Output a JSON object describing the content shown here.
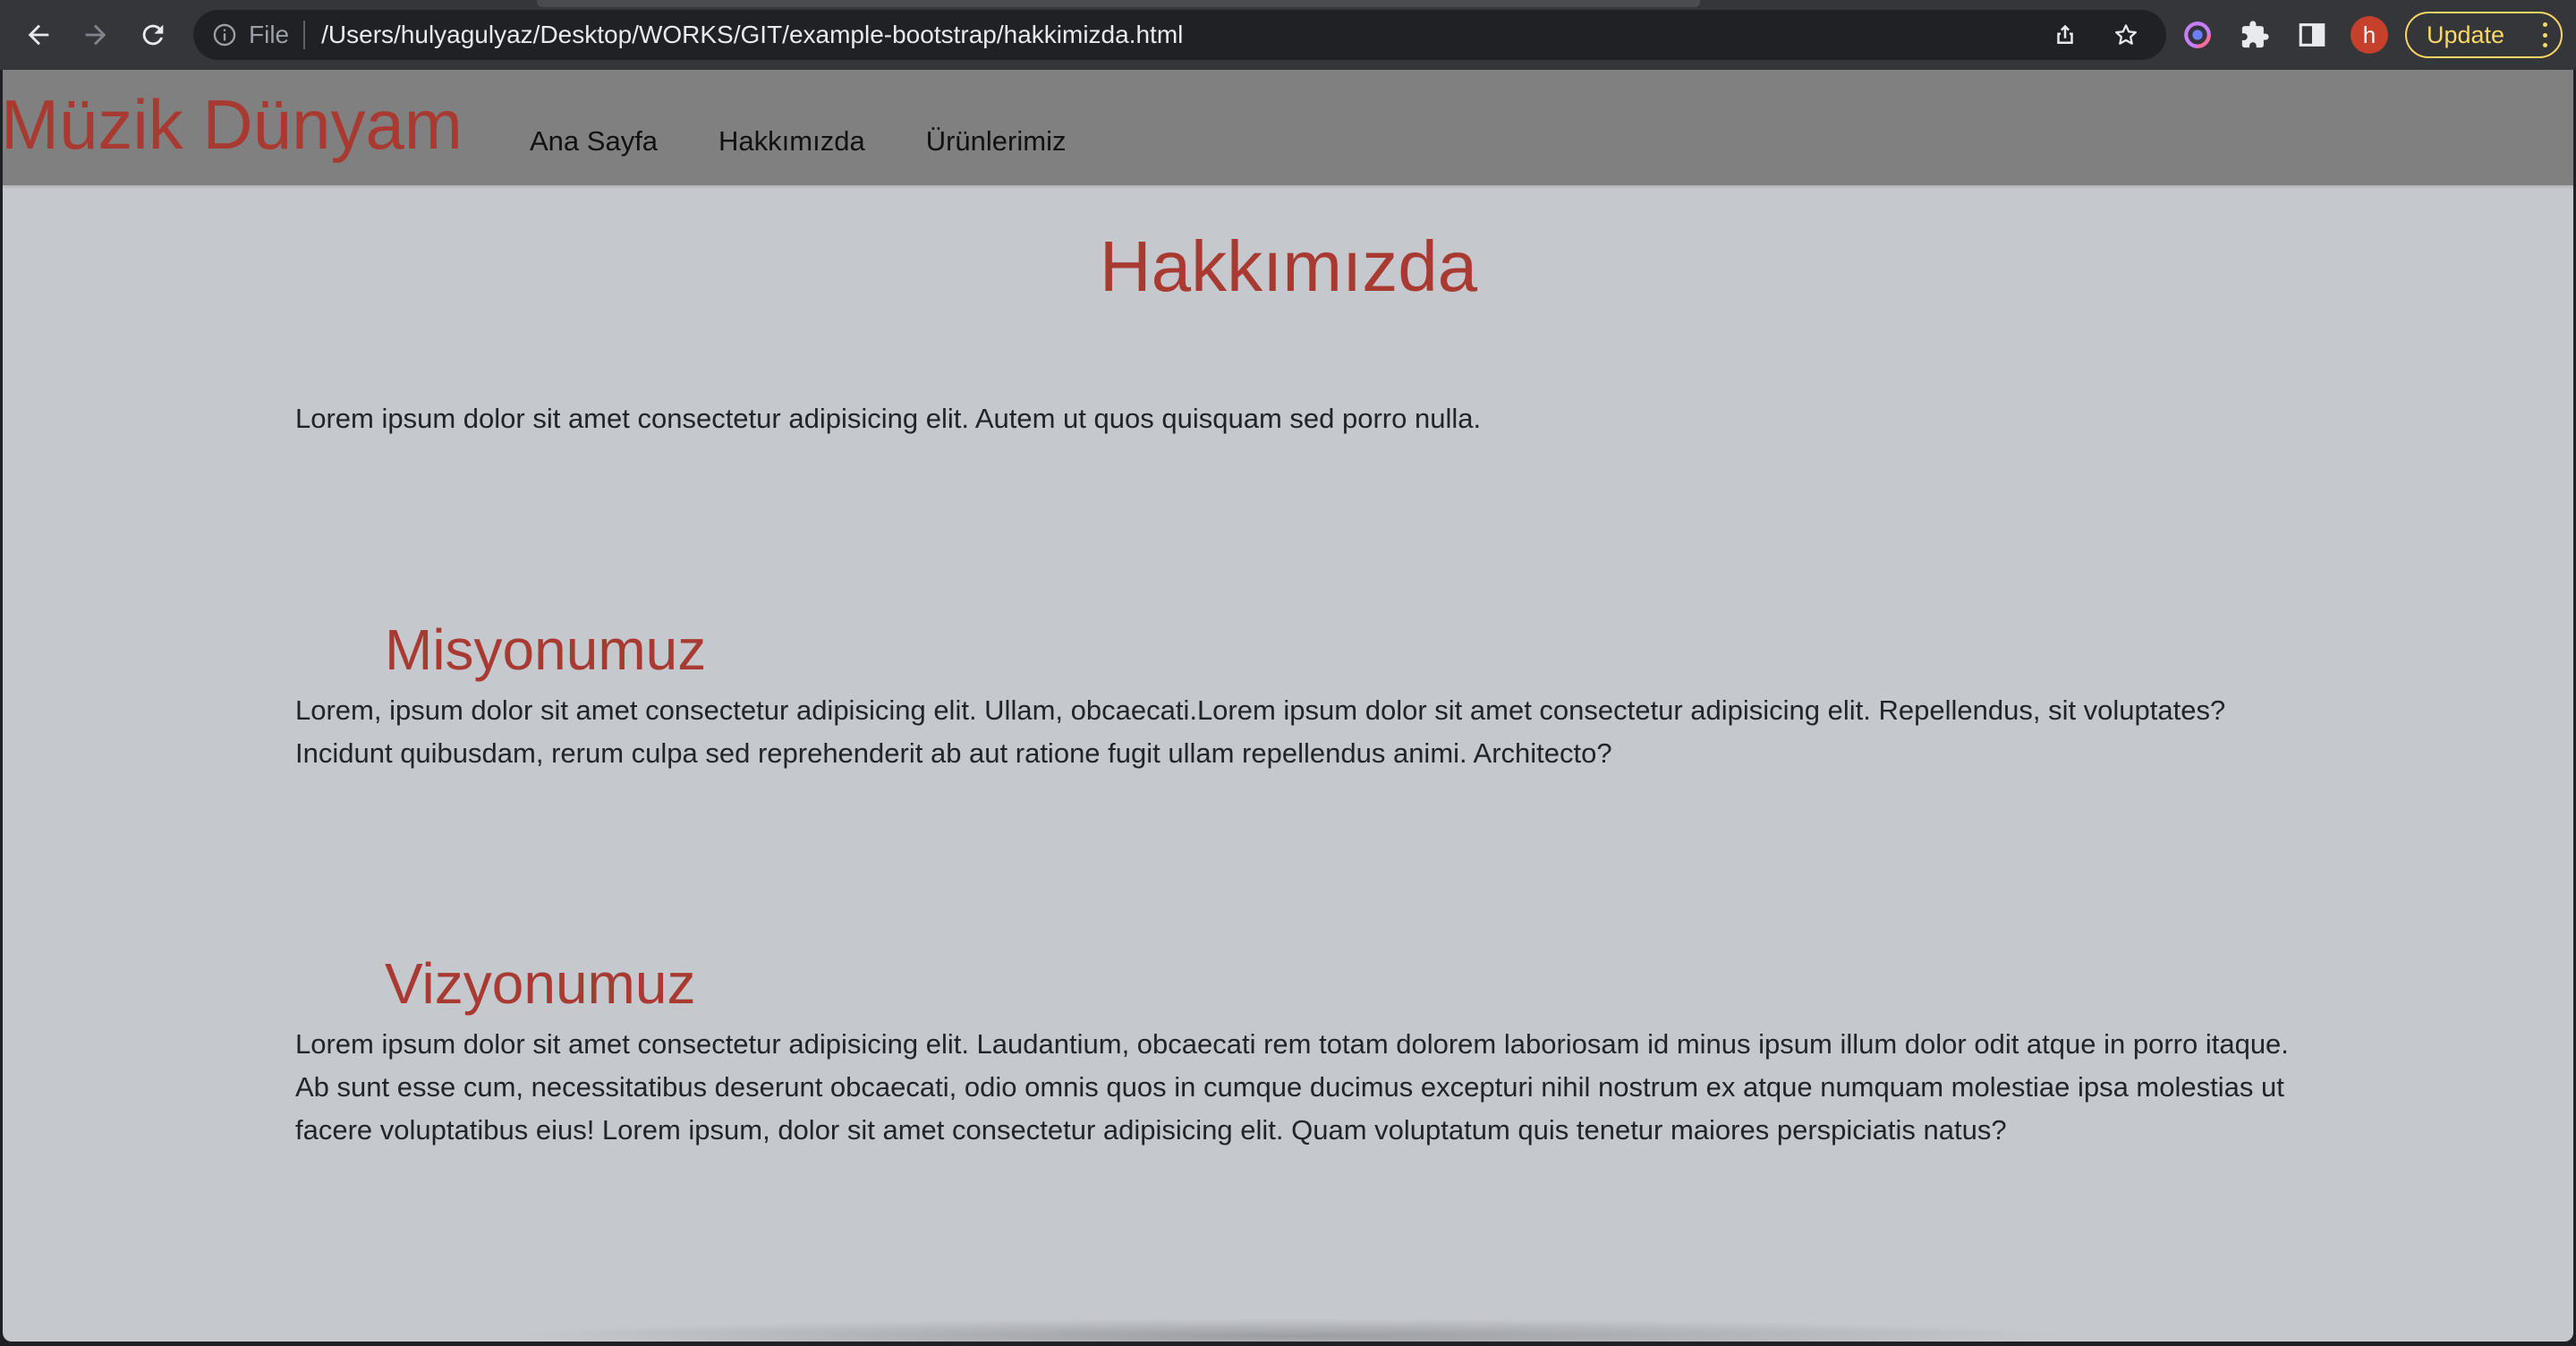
{
  "browser": {
    "scheme_label": "File",
    "url": "/Users/hulyagulyaz/Desktop/WORKS/GIT/example-bootstrap/hakkimizda.html",
    "profile_initial": "h",
    "update_label": "Update"
  },
  "site": {
    "brand": "Müzik Dünyam",
    "nav": [
      {
        "label": "Ana Sayfa"
      },
      {
        "label": "Hakkımızda"
      },
      {
        "label": "Ürünlerimiz"
      }
    ]
  },
  "page": {
    "title": "Hakkımızda",
    "intro": "Lorem ipsum dolor sit amet consectetur adipisicing elit. Autem ut quos quisquam sed porro nulla.",
    "sections": [
      {
        "heading": "Misyonumuz",
        "text": "Lorem, ipsum dolor sit amet consectetur adipisicing elit. Ullam, obcaecati.Lorem ipsum dolor sit amet consectetur adipisicing elit. Repellendus, sit voluptates? Incidunt quibusdam, rerum culpa sed reprehenderit ab aut ratione fugit ullam repellendus animi. Architecto?"
      },
      {
        "heading": "Vizyonumuz",
        "text": "Lorem ipsum dolor sit amet consectetur adipisicing elit. Laudantium, obcaecati rem totam dolorem laboriosam id minus ipsum illum dolor odit atque in porro itaque. Ab sunt esse cum, necessitatibus deserunt obcaecati, odio omnis quos in cumque ducimus excepturi nihil nostrum ex atque numquam molestiae ipsa molestias ut facere voluptatibus eius! Lorem ipsum, dolor sit amet consectetur adipisicing elit. Quam voluptatum quis tenetur maiores perspiciatis natus?"
      }
    ]
  },
  "colors": {
    "brand_red": "#a83a32",
    "nav_bg": "#808080",
    "page_bg": "#c5c8cd",
    "chrome_bg": "#35363a",
    "update_accent": "#fdd663"
  },
  "icons": [
    "back-arrow-icon",
    "forward-arrow-icon",
    "reload-icon",
    "info-icon",
    "share-icon",
    "star-icon",
    "extension-circle-icon",
    "puzzle-icon",
    "side-panel-icon",
    "kebab-menu-icon"
  ]
}
